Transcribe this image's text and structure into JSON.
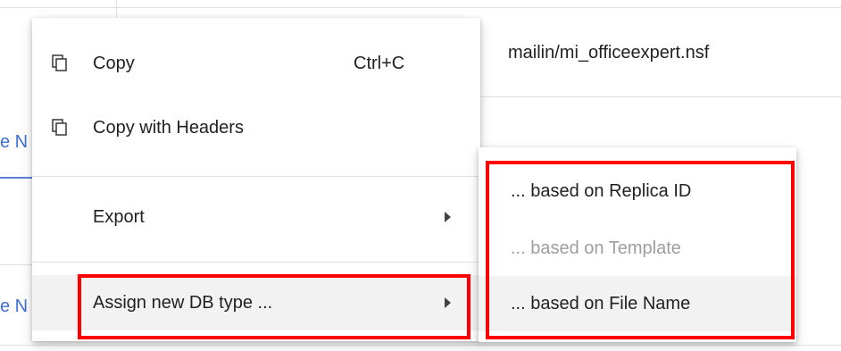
{
  "background": {
    "file_path": "mailin/mi_officeexpert.nsf",
    "edge_text_1": "e N",
    "edge_text_2": "e N"
  },
  "menu": {
    "items": [
      {
        "label": "Copy",
        "shortcut": "Ctrl+C",
        "icon": "copy-icon"
      },
      {
        "label": "Copy with Headers",
        "icon": "copy-icon"
      },
      {
        "label": "Export",
        "has_submenu": true
      },
      {
        "label": "Assign new DB type ...",
        "has_submenu": true,
        "highlighted": true
      }
    ]
  },
  "submenu": {
    "items": [
      {
        "label": "... based on Replica ID",
        "enabled": true
      },
      {
        "label": "... based on Template",
        "enabled": false
      },
      {
        "label": "... based on File Name",
        "enabled": true
      }
    ]
  },
  "colors": {
    "highlight_box": "#ff0000",
    "disabled_text": "#9e9e9e",
    "link_blue": "#3f6fd1"
  }
}
